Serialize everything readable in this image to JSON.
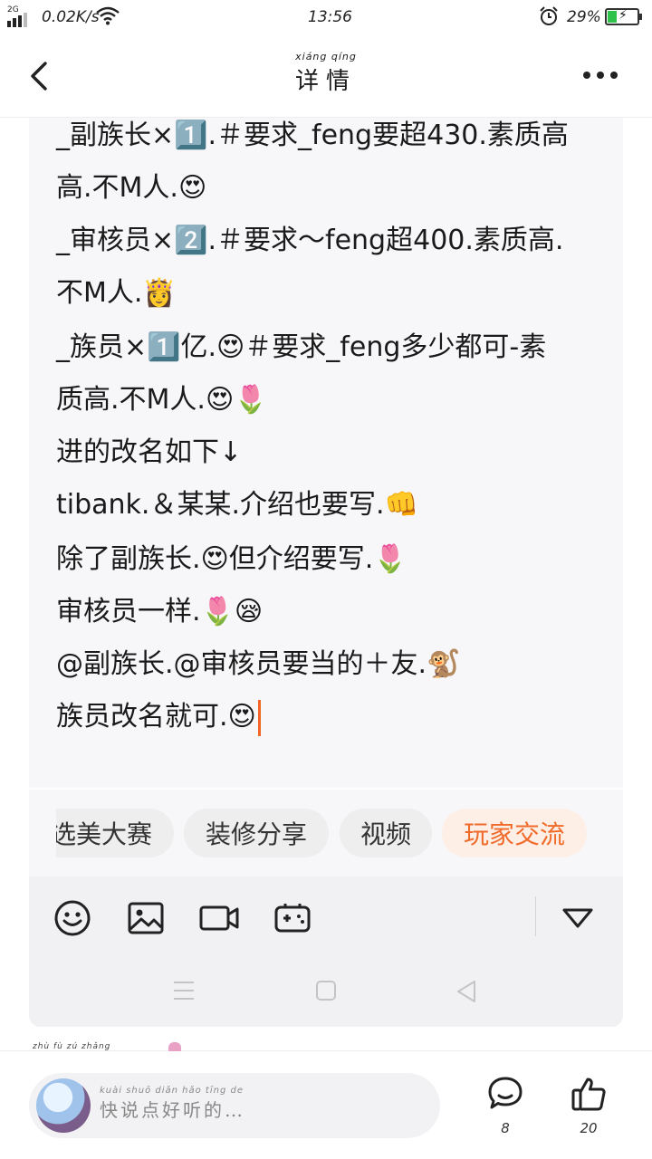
{
  "status_bar": {
    "network": "2G",
    "speed": "0.02K/s",
    "time": "13:56",
    "battery_percent": "29%",
    "battery_level": 0.29
  },
  "header": {
    "title_pinyin": "xiáng qíng",
    "title": "详情"
  },
  "post": {
    "lines": [
      "_副族长×1️⃣.＃要求_feng要超430.素质高",
      "高.不M人.😍",
      "_审核员×2️⃣.＃要求～feng超400.素质高.",
      "不M人.👸",
      "_族员×1️⃣亿.😍＃要求_feng多少都可-素",
      "质高.不M人.😍🌷",
      "进的改名如下↓",
      "tibank.＆某某.介绍也要写.👊",
      "除了副族长.😍但介绍要写.🌷",
      "审核员一样.🌷😪",
      "@副族长.@审核员要当的＋友.🐒",
      "族员改名就可.😍"
    ]
  },
  "topics": [
    {
      "label": "选美大赛",
      "active": false
    },
    {
      "label": "装修分享",
      "active": false
    },
    {
      "label": "视频",
      "active": false
    },
    {
      "label": "玩家交流",
      "active": true
    }
  ],
  "toolbar_icons": [
    "emoji-icon",
    "image-icon",
    "video-icon",
    "gamepad-icon",
    "collapse-triangle-icon"
  ],
  "bottom": {
    "clipped_pinyin": "zhù  fù  zú  zhǎng",
    "placeholder_pinyin": "kuài shuō diǎn hǎo tīng de",
    "placeholder": "快说点好听的…",
    "comment_count": "8",
    "like_count": "20"
  },
  "colors": {
    "accent": "#f06b2a",
    "caret": "#f26522",
    "battery": "#2ec24a"
  }
}
